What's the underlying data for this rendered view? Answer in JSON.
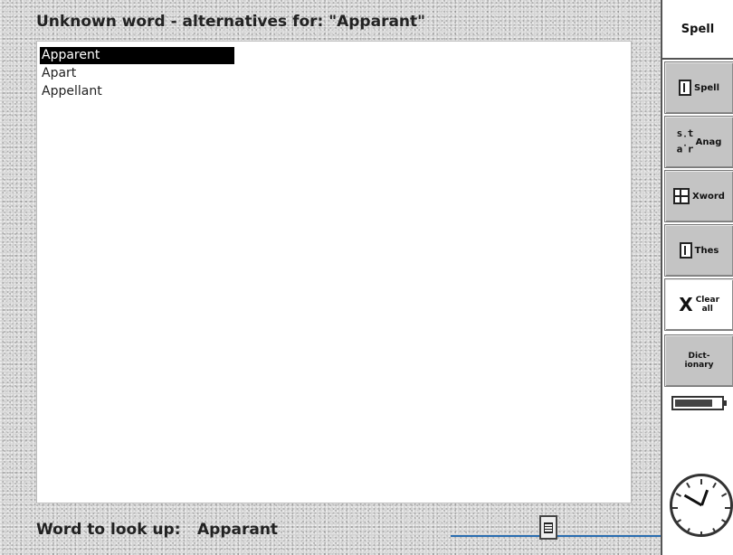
{
  "dialog": {
    "title": "Unknown word - alternatives for: \"Apparant\"",
    "alternatives": [
      {
        "label": "Apparent",
        "selected": true
      },
      {
        "label": "Apart",
        "selected": false
      },
      {
        "label": "Appellant",
        "selected": false
      }
    ],
    "lookup_label": "Word to look up:",
    "lookup_value": "Apparant"
  },
  "toolbar": {
    "title": "Spell",
    "buttons": [
      {
        "icon": "book-icon",
        "label": "Spell"
      },
      {
        "icon": "anagram-icon",
        "icon_text": "s t\na r",
        "label": "Anag"
      },
      {
        "icon": "crossword-icon",
        "label": "Xword"
      },
      {
        "icon": "book-icon",
        "label": "Thes"
      },
      {
        "icon": "clear-x-icon",
        "icon_text": "X",
        "label": "Clear all"
      },
      {
        "icon": "",
        "label": "Dict-ionary"
      }
    ],
    "battery_level": 0.82
  },
  "colors": {
    "lookup_line": "#2a6db0",
    "selection_bg": "#000000"
  }
}
